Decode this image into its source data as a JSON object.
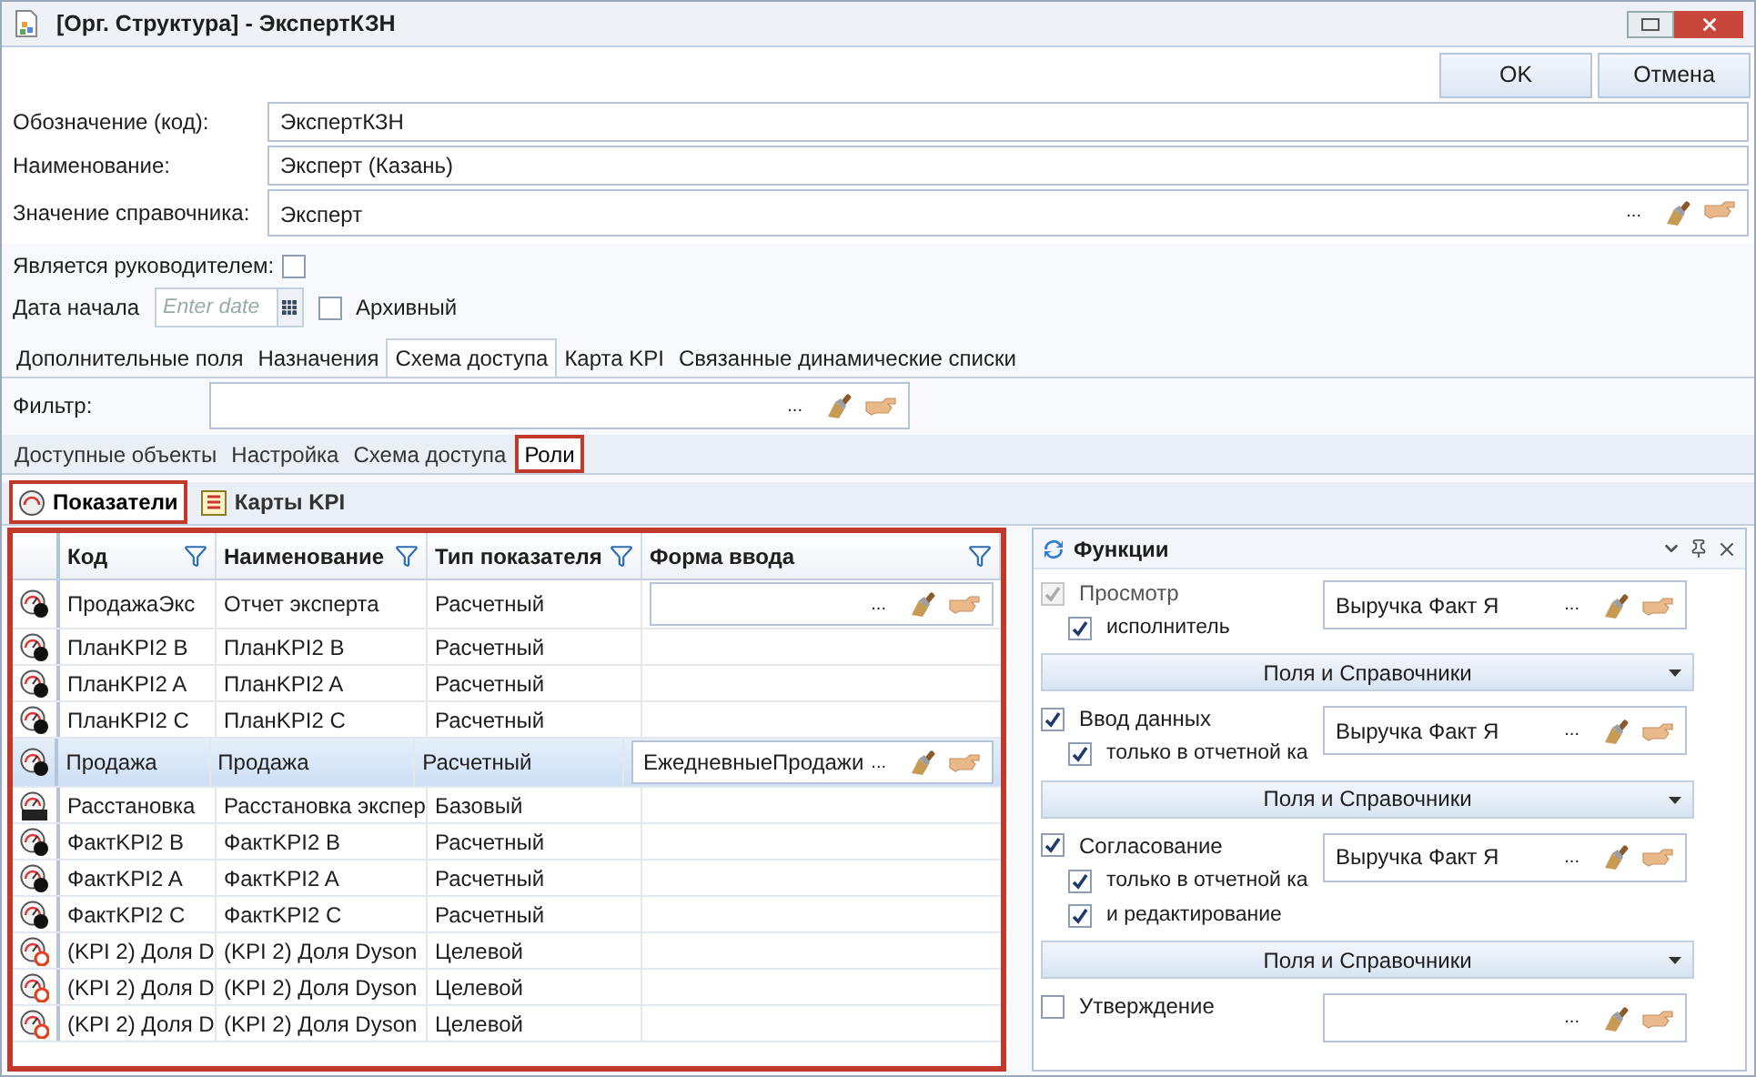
{
  "window": {
    "title": "[Орг. Структура] - ЭкспертКЗН"
  },
  "buttons": [
    "OK",
    "Отмена"
  ],
  "fields": [
    {
      "label": "Обозначение (код):",
      "value": "ЭкспертКЗН",
      "kind": "text"
    },
    {
      "label": "Наименование:",
      "value": "Эксперт (Казань)",
      "kind": "text"
    },
    {
      "label": "Значение справочника:",
      "value": "Эксперт",
      "kind": "lookup",
      "ellipsis": "..."
    }
  ],
  "is_manager": {
    "label": "Является руководителем:",
    "checked": false
  },
  "start_date": {
    "label": "Дата начала",
    "placeholder": "Enter date"
  },
  "archived": {
    "label": "Архивный",
    "checked": false
  },
  "tabs": [
    {
      "label": "Дополнительные поля",
      "selected": false
    },
    {
      "label": "Назначения",
      "selected": false
    },
    {
      "label": "Схема доступа",
      "selected": true
    },
    {
      "label": "Карта KPI",
      "selected": false
    },
    {
      "label": "Связанные динамические списки",
      "selected": false
    }
  ],
  "filter": {
    "label": "Фильтр:",
    "ellipsis": "..."
  },
  "subtabs": [
    {
      "label": "Доступные объекты",
      "selected": false,
      "highlighted": false
    },
    {
      "label": "Настройка",
      "selected": false,
      "highlighted": false
    },
    {
      "label": "Схема доступа",
      "selected": false,
      "highlighted": false
    },
    {
      "label": "Роли",
      "selected": true,
      "highlighted": true
    }
  ],
  "view_tabs": [
    {
      "label": "Показатели",
      "selected": true,
      "highlighted": true,
      "kind": "gauge"
    },
    {
      "label": "Карты KPI",
      "selected": false,
      "highlighted": false,
      "kind": "card"
    }
  ],
  "table": {
    "highlighted": true,
    "columns": [
      "Код",
      "Наименование",
      "Тип показателя",
      "Форма ввода"
    ],
    "rows": [
      {
        "kind": "calc",
        "code": "ПродажаЭкс",
        "name": "Отчет эксперта",
        "type": "Расчетный",
        "selected": false,
        "form_field": true,
        "ellipsis": "..."
      },
      {
        "kind": "calc",
        "code": "ПланKPI2 B",
        "name": "ПланKPI2 B",
        "type": "Расчетный",
        "selected": false,
        "form_field": false
      },
      {
        "kind": "calc",
        "code": "ПланKPI2  A",
        "name": "ПланKPI2 A",
        "type": "Расчетный",
        "selected": false,
        "form_field": false
      },
      {
        "kind": "calc",
        "code": "ПланKPI2 C",
        "name": "ПланKPI2 C",
        "type": "Расчетный",
        "selected": false,
        "form_field": false
      },
      {
        "kind": "calc",
        "code": "Продажа",
        "name": "Продажа",
        "type": "Расчетный",
        "selected": true,
        "form_field": true,
        "form_value": "ЕжедневныеПродажи",
        "ellipsis": "..."
      },
      {
        "kind": "base",
        "code": "Расстановка",
        "name": "Расстановка экспер",
        "type": "Базовый",
        "selected": false,
        "form_field": false
      },
      {
        "kind": "calc",
        "code": "ФактKPI2 B",
        "name": "ФактKPI2 B",
        "type": "Расчетный",
        "selected": false,
        "form_field": false
      },
      {
        "kind": "calc",
        "code": "ФактKPI2 A",
        "name": "ФактKPI2 A",
        "type": "Расчетный",
        "selected": false,
        "form_field": false
      },
      {
        "kind": "calc",
        "code": "ФактKPI2 C",
        "name": "ФактKPI2 C",
        "type": "Расчетный",
        "selected": false,
        "form_field": false
      },
      {
        "kind": "target",
        "code": "(KPI 2) Доля D",
        "name": "(KPI 2) Доля Dyson",
        "type": "Целевой",
        "selected": false,
        "form_field": false
      },
      {
        "kind": "target",
        "code": "(KPI 2) Доля D",
        "name": "(KPI 2) Доля Dyson",
        "type": "Целевой",
        "selected": false,
        "form_field": false
      },
      {
        "kind": "target",
        "code": "(KPI 2) Доля D",
        "name": "(KPI 2) Доля Dyson",
        "type": "Целевой",
        "selected": false,
        "form_field": false
      }
    ]
  },
  "functions": {
    "title": "Функции",
    "groups": [
      {
        "label": "Просмотр",
        "checked": true,
        "disabled": true,
        "options": [
          {
            "label": "исполнитель",
            "checked": true
          }
        ],
        "value": "Выручка Факт Я",
        "ellipsis": "...",
        "fields_button": "Поля и Справочники"
      },
      {
        "label": "Ввод данных",
        "checked": true,
        "disabled": false,
        "options": [
          {
            "label": "только в отчетной ка",
            "checked": true
          }
        ],
        "value": "Выручка Факт Я",
        "ellipsis": "...",
        "fields_button": "Поля и Справочники"
      },
      {
        "label": "Согласование",
        "checked": true,
        "disabled": false,
        "options": [
          {
            "label": "только в отчетной ка",
            "checked": true
          },
          {
            "label": "и редактирование",
            "checked": true
          }
        ],
        "value": "Выручка Факт Я",
        "ellipsis": "...",
        "fields_button": "Поля и Справочники"
      },
      {
        "label": "Утверждение",
        "checked": false,
        "disabled": false,
        "ellipsis": "..."
      }
    ]
  }
}
